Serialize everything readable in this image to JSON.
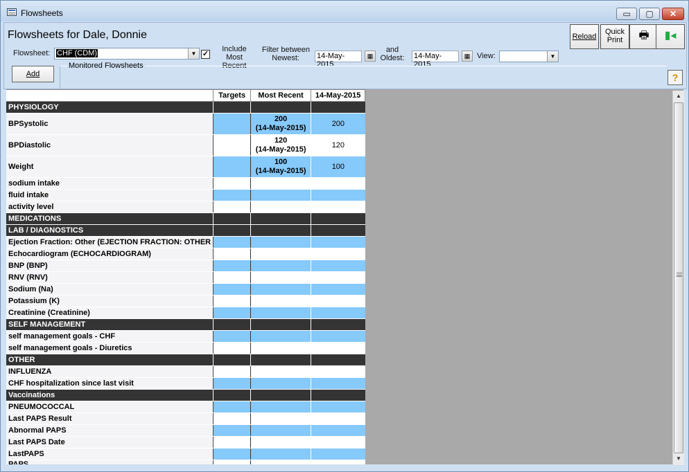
{
  "window": {
    "title": "Flowsheets",
    "minimize_glyph": "▭",
    "maximize_glyph": "▢",
    "close_glyph": "✕"
  },
  "header": {
    "form_title": "Flowsheets for Dale, Donnie",
    "flowsheet_label": "Flowsheet:",
    "flowsheet_value": "CHF (CDM)",
    "include_most_recent_line1": "Include Most",
    "include_most_recent_line2": "Recent",
    "include_most_recent_checked": true,
    "filter_line1": "Filter between",
    "filter_line2": "Newest:",
    "newest_date": "14-May-2015",
    "and_line1": "and",
    "and_line2": "Oldest:",
    "oldest_date": "14-May-2015",
    "view_label": "View:",
    "view_value": "",
    "reload_label": "Reload",
    "quick_print_line1": "Quick",
    "quick_print_line2": "Print",
    "add_label": "Add",
    "monitored_label": "Monitored Flowsheets",
    "help_glyph": "?"
  },
  "grid": {
    "columns": [
      "Targets",
      "Most Recent",
      "14-May-2015"
    ],
    "rows": [
      {
        "name": "PHYSIOLOGY",
        "type": "section"
      },
      {
        "name": "BPSystolic",
        "type": "blue",
        "tall": true,
        "recent_value": "200",
        "recent_date": "(14-May-2015)",
        "value": "200"
      },
      {
        "name": "BPDiastolic",
        "type": "white",
        "tall": true,
        "recent_value": "120",
        "recent_date": "(14-May-2015)",
        "value": "120"
      },
      {
        "name": "Weight",
        "type": "blue",
        "tall": true,
        "recent_value": "100",
        "recent_date": "(14-May-2015)",
        "value": "100"
      },
      {
        "name": "sodium intake",
        "type": "white"
      },
      {
        "name": "fluid intake",
        "type": "blue"
      },
      {
        "name": "activity level",
        "type": "white"
      },
      {
        "name": "MEDICATIONS",
        "type": "section"
      },
      {
        "name": "LAB / DIAGNOSTICS",
        "type": "section"
      },
      {
        "name": "Ejection Fraction: Other (EJECTION FRACTION: OTHER",
        "type": "blue"
      },
      {
        "name": "Echocardiogram (ECHOCARDIOGRAM)",
        "type": "white"
      },
      {
        "name": "BNP (BNP)",
        "type": "blue"
      },
      {
        "name": "RNV (RNV)",
        "type": "white"
      },
      {
        "name": "Sodium (Na)",
        "type": "blue"
      },
      {
        "name": "Potassium (K)",
        "type": "white"
      },
      {
        "name": "Creatinine (Creatinine)",
        "type": "blue"
      },
      {
        "name": "SELF MANAGEMENT",
        "type": "section"
      },
      {
        "name": "self management goals - CHF",
        "type": "blue"
      },
      {
        "name": "self management goals - Diuretics",
        "type": "white"
      },
      {
        "name": "OTHER",
        "type": "section"
      },
      {
        "name": "INFLUENZA",
        "type": "white"
      },
      {
        "name": "CHF hospitalization since last visit",
        "type": "blue"
      },
      {
        "name": "Vaccinations",
        "type": "section"
      },
      {
        "name": "PNEUMOCOCCAL",
        "type": "blue"
      },
      {
        "name": "Last PAPS Result",
        "type": "white"
      },
      {
        "name": "Abnormal PAPS",
        "type": "blue"
      },
      {
        "name": "Last PAPS Date",
        "type": "white"
      },
      {
        "name": "LastPAPS",
        "type": "blue"
      },
      {
        "name": "PAPS",
        "type": "white",
        "partial": true
      }
    ]
  },
  "colors": {
    "row_blue": "#86c9fb",
    "section_bg": "#343434",
    "grid_bg": "#a9a9a9"
  }
}
